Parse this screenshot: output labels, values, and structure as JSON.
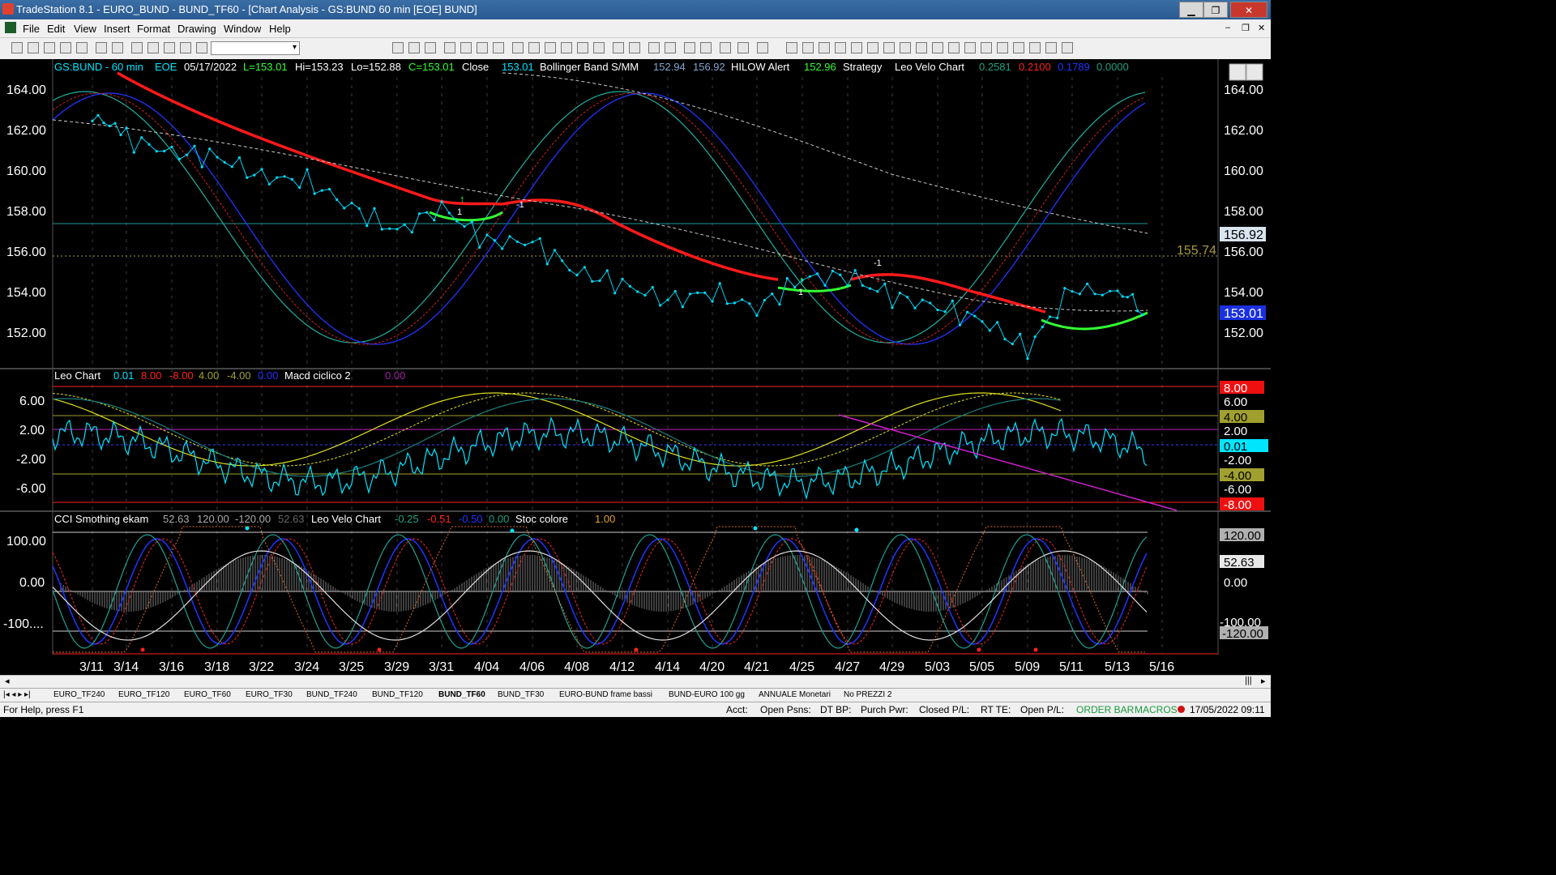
{
  "window": {
    "title": "TradeStation 8.1 - EURO_BUND - BUND_TF60 - [Chart Analysis - GS:BUND  60 min  [EOE] BUND]",
    "min": "▁",
    "max": "❐",
    "close": "✕"
  },
  "menu": [
    "File",
    "Edit",
    "View",
    "Insert",
    "Format",
    "Drawing",
    "Window",
    "Help"
  ],
  "toolbar": {
    "combo_value": ""
  },
  "chart_header": {
    "symbol": "GS:BUND - 60 min",
    "session": "EOE",
    "date": "05/17/2022",
    "last": "L=153.01",
    "hi": "Hi=153.23",
    "lo": "Lo=152.88",
    "close_c": "C=153.01",
    "close_label": "Close",
    "close_val": "153.01",
    "bb_label": "Bollinger Band S/MM",
    "bb_v1": "152.94",
    "bb_v2": "156.92",
    "hilow_label": "HILOW Alert",
    "hilow_v": "152.96",
    "strategy": "Strategy",
    "leo_velo": "Leo Velo Chart",
    "lv1": "0.2581",
    "lv2": "0.2100",
    "lv3": "0.1789",
    "lv4": "0.0000"
  },
  "panel1": {
    "y_ticks": [
      "164.00",
      "162.00",
      "160.00",
      "158.00",
      "156.00",
      "154.00",
      "152.00"
    ],
    "level_label": "155.74",
    "bb_box": "156.92",
    "price_box": "153.01",
    "markers": [
      "1",
      "-1",
      "1",
      "-1"
    ]
  },
  "panel2": {
    "legend": {
      "name": "Leo Chart",
      "v1": "0.01",
      "v2": "8.00",
      "v3": "-8.00",
      "v4": "4.00",
      "v5": "-4.00",
      "v6": "0.00",
      "macd": "Macd ciclico 2",
      "v7": "0.00"
    },
    "y_ticks": [
      "6.00",
      "2.00",
      "-2.00",
      "-6.00"
    ],
    "right_boxes": [
      "8.00",
      "6.00",
      "4.00",
      "2.00",
      "0.01",
      "-2.00",
      "-4.00",
      "-6.00",
      "-8.00"
    ]
  },
  "panel3": {
    "legend": {
      "name": "CCI Smothing ekam",
      "v1": "52.63",
      "v2": "120.00",
      "v3": "-120.00",
      "v4": "52.63",
      "lv": "Leo Velo Chart",
      "l1": "-0.25",
      "l2": "-0.51",
      "l3": "-0.50",
      "l4": "0.00",
      "stoc": "Stoc colore",
      "s1": "1.00"
    },
    "y_ticks": [
      "100.00",
      "0.00",
      "-100...."
    ],
    "right_boxes": [
      "120.00",
      "52.63",
      "0.00",
      "-100.00",
      "-120.00"
    ]
  },
  "x_axis": [
    "3/11",
    "3/14",
    "3/16",
    "3/18",
    "3/22",
    "3/24",
    "3/25",
    "3/29",
    "3/31",
    "4/04",
    "4/06",
    "4/08",
    "4/12",
    "4/14",
    "4/20",
    "4/21",
    "4/25",
    "4/27",
    "4/29",
    "5/03",
    "5/05",
    "5/09",
    "5/11",
    "5/13",
    "5/16"
  ],
  "tabs": [
    "EURO_TF240",
    "EURO_TF120",
    "EURO_TF60",
    "EURO_TF30",
    "BUND_TF240",
    "BUND_TF120",
    "BUND_TF60",
    "BUND_TF30",
    "EURO-BUND frame bassi",
    "BUND-EURO 100 gg",
    "ANNUALE Monetari",
    "No PREZZI 2"
  ],
  "active_tab": "BUND_TF60",
  "status": {
    "help": "For Help, press F1",
    "acct": "Acct:",
    "open_psns": "Open Psns:",
    "dtbp": "DT BP:",
    "purch": "Purch Pwr:",
    "closed": "Closed P/L:",
    "rtte": "RT TE:",
    "openpl": "Open P/L:",
    "order": "ORDER BAR",
    "macros": "MACROS",
    "datetime": "17/05/2022 09:11"
  },
  "colors": {
    "cyan": "#00e5ff",
    "red": "#ff1a1a",
    "green": "#33ff33",
    "blue": "#2233ff",
    "yellow": "#e0e020",
    "magenta": "#d020d0",
    "white_dash": "#c8c8c8",
    "title_bar": "#2a5a92"
  },
  "chart_data": {
    "type": "line",
    "x": [
      "3/11",
      "3/14",
      "3/16",
      "3/18",
      "3/22",
      "3/24",
      "3/25",
      "3/29",
      "3/31",
      "4/04",
      "4/06",
      "4/08",
      "4/12",
      "4/14",
      "4/20",
      "4/21",
      "4/25",
      "4/27",
      "4/29",
      "5/03",
      "5/05",
      "5/09",
      "5/11",
      "5/13",
      "5/16"
    ],
    "series": [
      {
        "name": "Close",
        "values": [
          162.6,
          161.8,
          161.1,
          160.9,
          159.9,
          159.7,
          158.4,
          157.2,
          158.4,
          156.7,
          156.7,
          155.2,
          154.6,
          153.8,
          154.2,
          153.4,
          154.9,
          155.0,
          154.0,
          153.5,
          152.8,
          151.4,
          154.4,
          154.1,
          153.01
        ]
      }
    ],
    "ylim": [
      150.4,
      165.4
    ]
  }
}
